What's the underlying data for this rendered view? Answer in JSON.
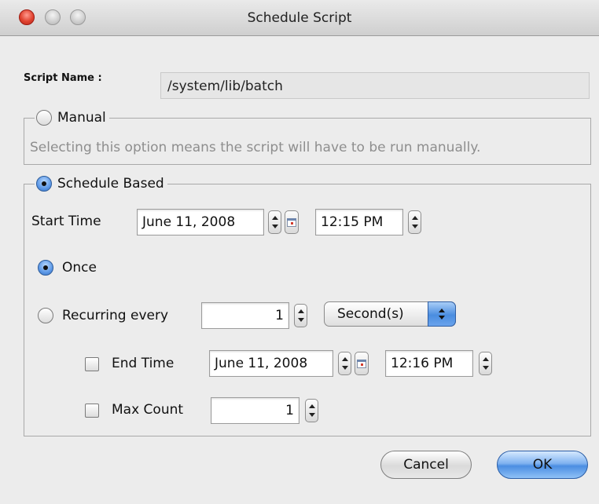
{
  "window": {
    "title": "Schedule Script"
  },
  "script_name": {
    "label": "Script Name :",
    "value": "/system/lib/batch"
  },
  "manual": {
    "label": "Manual",
    "selected": false,
    "description": "Selecting this option means the script will have to be run manually."
  },
  "schedule": {
    "label": "Schedule Based",
    "selected": true,
    "start_time": {
      "label": "Start Time",
      "date": "June 11, 2008",
      "time": "12:15 PM"
    },
    "once": {
      "label": "Once",
      "selected": true
    },
    "recurring": {
      "label": "Recurring every",
      "selected": false,
      "value": "1",
      "unit": "Second(s)"
    },
    "end_time": {
      "label": "End Time",
      "checked": false,
      "date": "June 11, 2008",
      "time": "12:16 PM"
    },
    "max_count": {
      "label": "Max Count",
      "checked": false,
      "value": "1"
    }
  },
  "buttons": {
    "cancel": "Cancel",
    "ok": "OK"
  },
  "colors": {
    "accent": "#4b8ee2",
    "background": "#ececec",
    "close": "#e0422f"
  }
}
